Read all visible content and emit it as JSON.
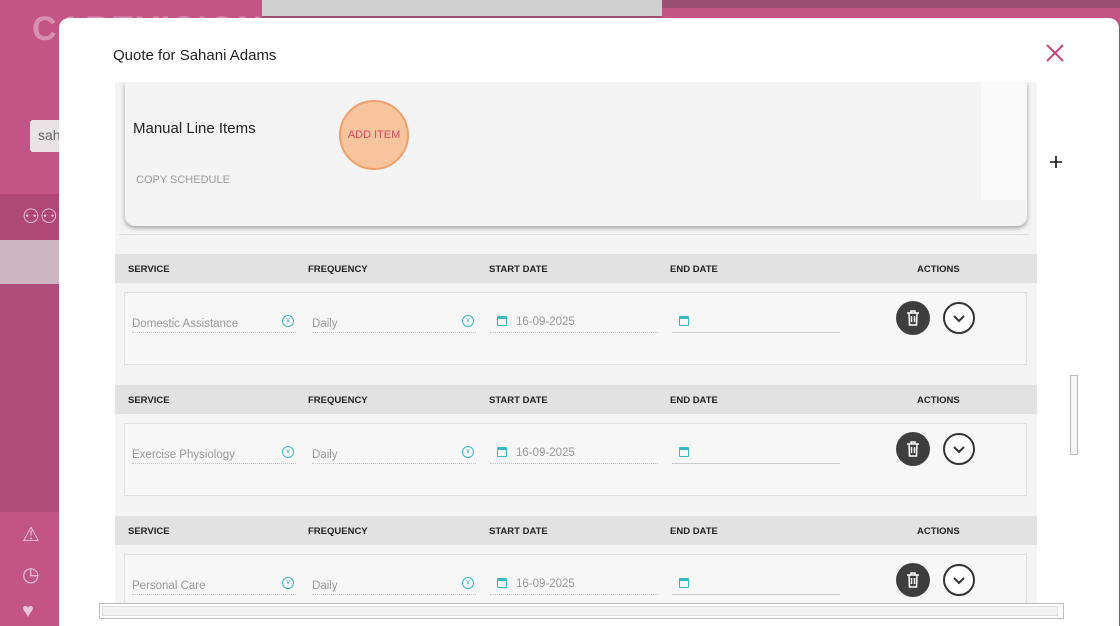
{
  "background": {
    "logo_text": "CAREVISION",
    "search_value": "sah"
  },
  "modal": {
    "title": "Quote for Sahani Adams"
  },
  "manual": {
    "title": "Manual Line Items",
    "add_item_label": "ADD ITEM",
    "copy_schedule_label": "COPY SCHEDULE"
  },
  "table": {
    "headers": {
      "service": "SERVICE",
      "frequency": "FREQUENCY",
      "start_date": "START DATE",
      "end_date": "END DATE",
      "actions": "ACTIONS"
    },
    "rows": [
      {
        "service": "Domestic Assistance",
        "frequency": "Daily",
        "start_date": "16-09-2025",
        "end_date": ""
      },
      {
        "service": "Exercise Physiology",
        "frequency": "Daily",
        "start_date": "16-09-2025",
        "end_date": ""
      },
      {
        "service": "Personal Care",
        "frequency": "Daily",
        "start_date": "16-09-2025",
        "end_date": ""
      }
    ]
  },
  "colors": {
    "accent_pink": "#c25585",
    "teal": "#38b8c4",
    "add_item_fill": "#f8c49e"
  }
}
